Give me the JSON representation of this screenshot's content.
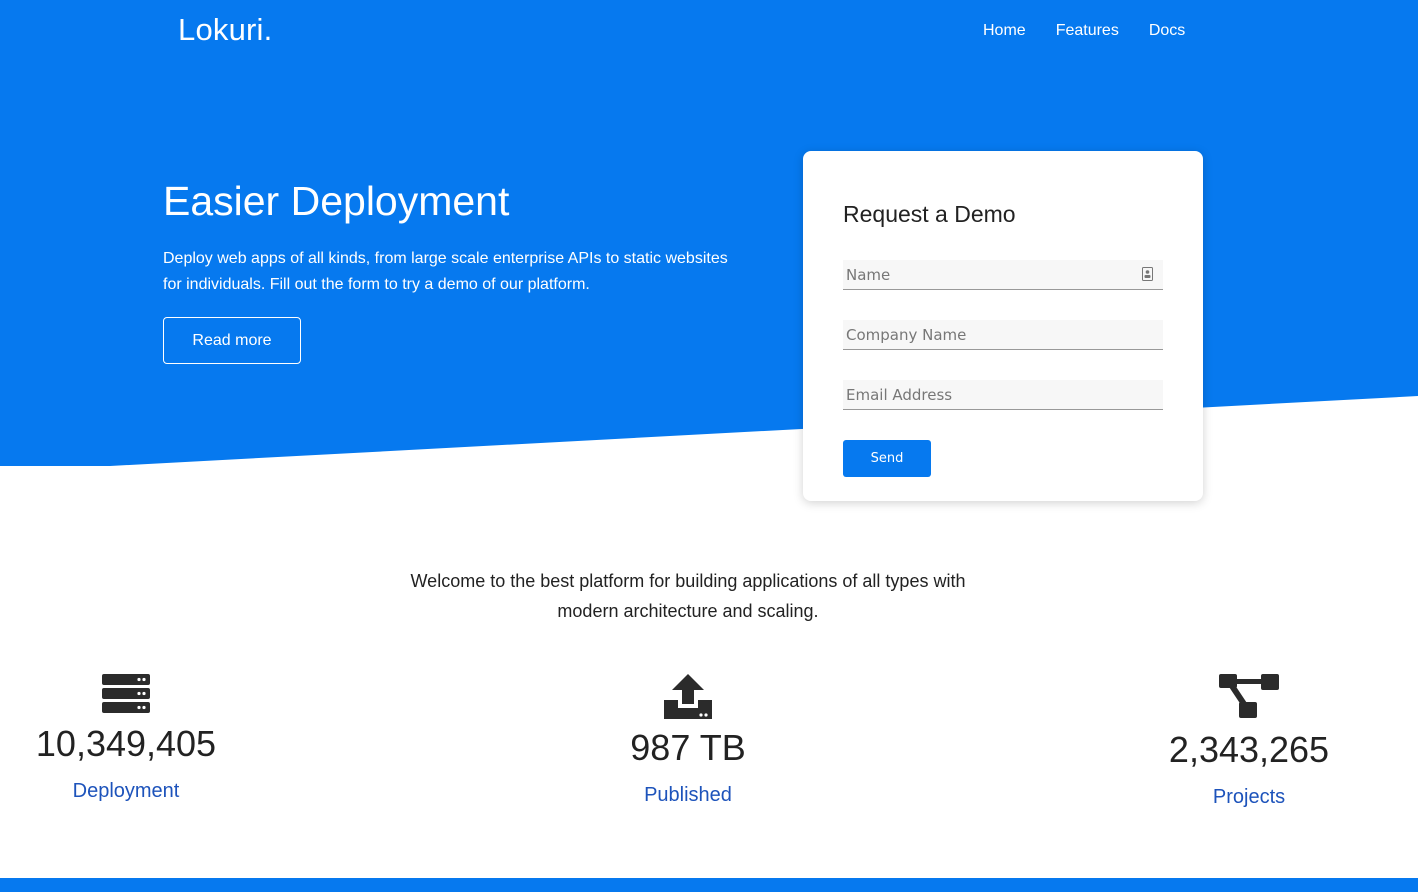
{
  "colors": {
    "brand_blue": "#0679ef",
    "stat_label": "#1d53bb",
    "text_dark": "#222222"
  },
  "header": {
    "brand": "Lokuri.",
    "nav": [
      "Home",
      "Features",
      "Docs"
    ]
  },
  "hero": {
    "title": "Easier Deployment",
    "text": "Deploy web apps of all kinds, from large scale enterprise APIs to static websites for individuals. Fill out the form to try a demo of our platform.",
    "button": "Read more"
  },
  "demo_form": {
    "title": "Request a Demo",
    "name_placeholder": "Name",
    "company_placeholder": "Company Name",
    "email_placeholder": "Email Address",
    "send": "Send"
  },
  "welcome": "Welcome to the best platform for building applications of all types with modern architecture and scaling.",
  "stats": [
    {
      "icon": "server-icon",
      "value": "10,349,405",
      "label": "Deployment"
    },
    {
      "icon": "upload-icon",
      "value": "987 TB",
      "label": "Published"
    },
    {
      "icon": "sitemap-icon",
      "value": "2,343,265",
      "label": "Projects"
    }
  ]
}
